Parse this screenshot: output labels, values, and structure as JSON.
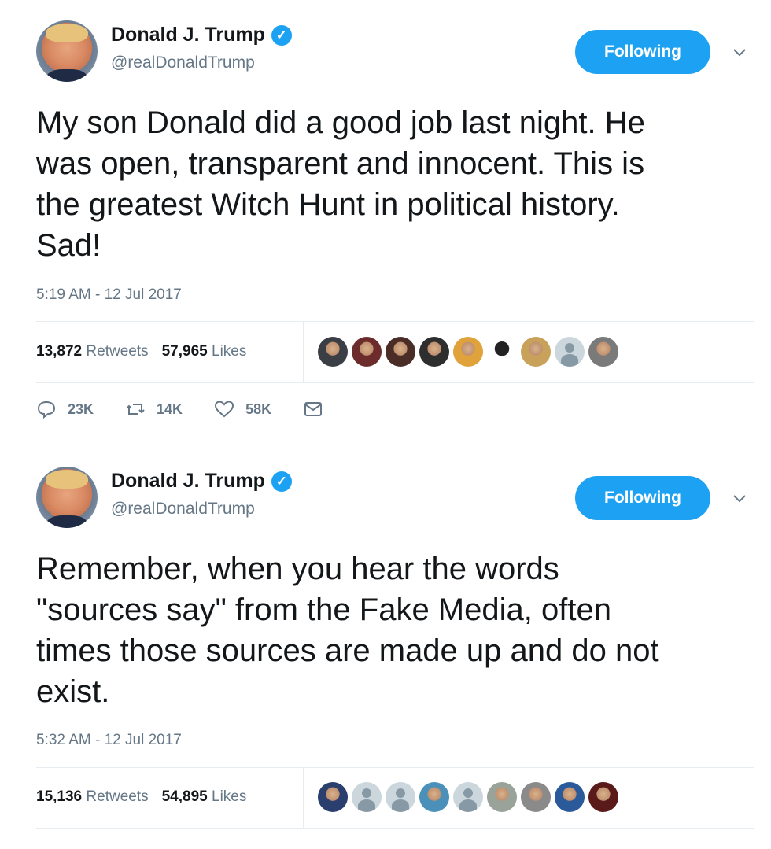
{
  "tweets": [
    {
      "author": {
        "name": "Donald J. Trump",
        "handle": "@realDonaldTrump",
        "verified": true
      },
      "follow_button": "Following",
      "text": "My son Donald did a good job last night. He\nwas open, transparent and innocent. This is\nthe greatest Witch Hunt in political history.\nSad!",
      "timestamp": "5:19 AM - 12 Jul 2017",
      "stats": {
        "retweets_count": "13,872",
        "retweets_label": "Retweets",
        "likes_count": "57,965",
        "likes_label": "Likes"
      },
      "likers": [
        "#3b3f45",
        "#6d2c2c",
        "#4a2d26",
        "#2e2e2e",
        "#e0a23a",
        "#ffffff",
        "#c8a25a",
        "default",
        "#7a7a7a"
      ],
      "actions": {
        "replies": "23K",
        "retweets": "14K",
        "likes": "58K"
      }
    },
    {
      "author": {
        "name": "Donald J. Trump",
        "handle": "@realDonaldTrump",
        "verified": true
      },
      "follow_button": "Following",
      "text": "Remember, when you hear the words\n\"sources say\" from the Fake Media, often\ntimes those sources are made up and do not\nexist.",
      "timestamp": "5:32 AM - 12 Jul 2017",
      "stats": {
        "retweets_count": "15,136",
        "retweets_label": "Retweets",
        "likes_count": "54,895",
        "likes_label": "Likes"
      },
      "likers": [
        "#2a3f6e",
        "default",
        "default",
        "#4a90b8",
        "default",
        "#9aa39a",
        "#8a8a8a",
        "#2a5a9a",
        "#5a1a1a"
      ]
    }
  ],
  "colors": {
    "accent": "#1da1f2",
    "muted_text": "#657786",
    "primary_text": "#14171a",
    "divider": "#e6ecf0"
  },
  "icons": [
    "verified-badge-icon",
    "chevron-down-icon",
    "reply-icon",
    "retweet-icon",
    "heart-icon",
    "direct-message-icon"
  ]
}
